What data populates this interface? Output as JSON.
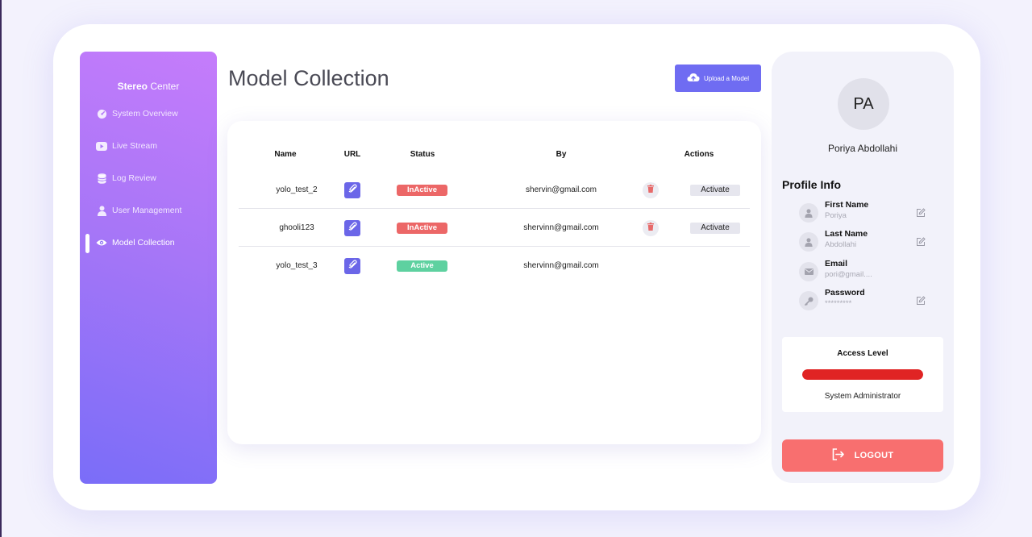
{
  "app": {
    "brand_bold": "Stereo",
    "brand_light": "Center"
  },
  "sidebar": {
    "items": [
      {
        "label": "System Overview",
        "icon": "dashboard-icon"
      },
      {
        "label": "Live Stream",
        "icon": "video-icon"
      },
      {
        "label": "Log Review",
        "icon": "database-icon"
      },
      {
        "label": "User Management",
        "icon": "user-icon"
      },
      {
        "label": "Model Collection",
        "icon": "eye-icon",
        "active": true
      }
    ]
  },
  "main": {
    "title": "Model Collection",
    "upload_label": "Upload a Model"
  },
  "table": {
    "headers": {
      "name": "Name",
      "url": "URL",
      "status": "Status",
      "by": "By",
      "actions": "Actions"
    },
    "rows": [
      {
        "name": "yolo_test_2",
        "status": "InActive",
        "by": "shervin@gmail.com",
        "action": "Activate"
      },
      {
        "name": "ghooli123",
        "status": "InActive",
        "by": "shervinn@gmail.com",
        "action": "Activate"
      },
      {
        "name": "yolo_test_3",
        "status": "Active",
        "by": "shervinn@gmail.com",
        "action": ""
      }
    ]
  },
  "profile": {
    "initials": "PA",
    "name": "Poriya Abdollahi",
    "info_title": "Profile Info",
    "fields": [
      {
        "label": "First Name",
        "value": "Poriya",
        "editable": true
      },
      {
        "label": "Last Name",
        "value": "Abdollahi",
        "editable": true
      },
      {
        "label": "Email",
        "value": "pori@gmail....",
        "editable": false
      },
      {
        "label": "Password",
        "value": "*********",
        "editable": true
      }
    ],
    "access_title": "Access Level",
    "access_level": 1.0,
    "access_role": "System Administrator",
    "logout_label": "LOGOUT"
  },
  "colors": {
    "accent": "#6f6cf2",
    "inactive": "#ec6767",
    "active": "#5ed1a0",
    "danger": "#e02424",
    "logout": "#f86f6f"
  }
}
